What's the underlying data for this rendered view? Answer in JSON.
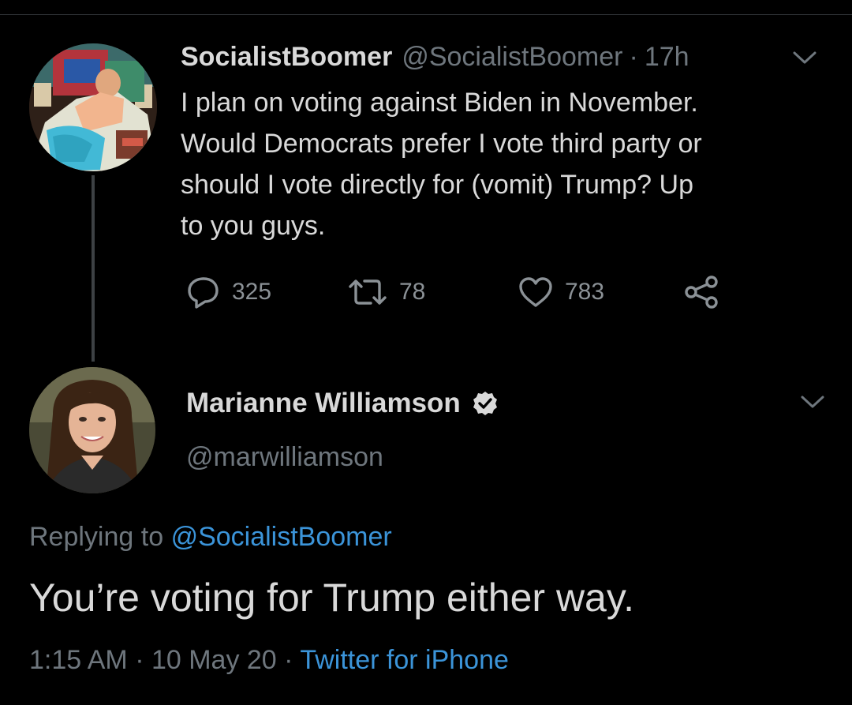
{
  "colors": {
    "background": "#000000",
    "text_primary": "#d9d9d9",
    "text_secondary": "#6e767d",
    "link": "#3b94d9",
    "divider": "#2f3336"
  },
  "tweet_original": {
    "display_name": "SocialistBoomer",
    "handle": "@SocialistBoomer",
    "separator": "·",
    "time": "17h",
    "menu_icon": "chevron-down-icon",
    "text": "I plan on voting against Biden in November.\nWould Democrats prefer I vote third party or\nshould I vote directly for (vomit) Trump? Up\nto you guys.",
    "actions": {
      "reply_count": "325",
      "retweet_count": "78",
      "like_count": "783",
      "reply_icon": "reply-icon",
      "retweet_icon": "retweet-icon",
      "like_icon": "heart-icon",
      "share_icon": "share-icon"
    }
  },
  "tweet_reply": {
    "display_name": "Marianne Williamson",
    "verified_icon": "verified-badge-icon",
    "handle": "@marwilliamson",
    "menu_icon": "chevron-down-icon",
    "replying_prefix": "Replying to",
    "replying_handle": "@SocialistBoomer",
    "text": "You’re voting for Trump either way.",
    "timestamp": "1:15 AM · 10 May 20 ·",
    "source": "Twitter for iPhone"
  }
}
